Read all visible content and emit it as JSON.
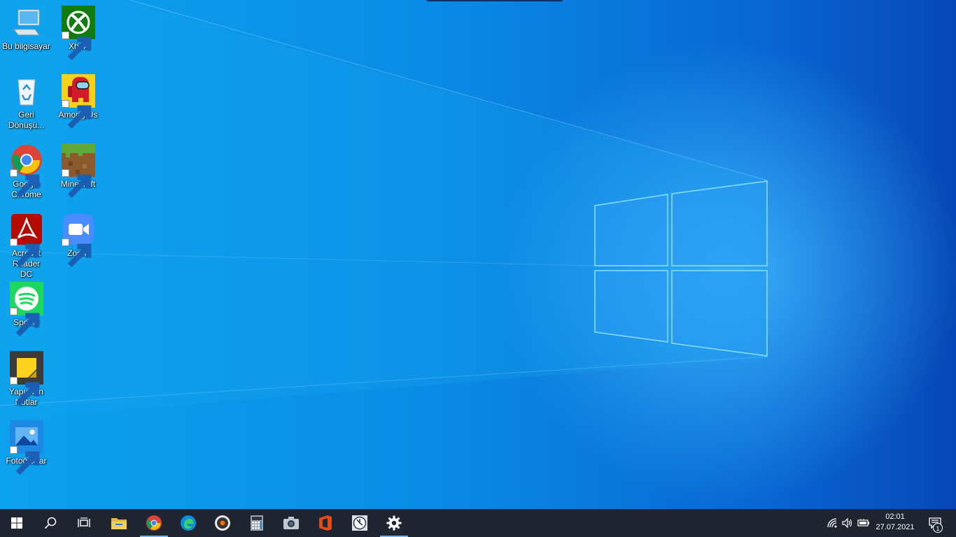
{
  "desktop": {
    "icons": [
      {
        "label": "Bu bilgisayar",
        "icon": "this-pc-icon"
      },
      {
        "label": "Xbox",
        "icon": "xbox-icon"
      },
      {
        "label": "Geri Dönüşü...",
        "icon": "recycle-bin-icon"
      },
      {
        "label": "Among Us",
        "icon": "among-us-icon"
      },
      {
        "label": "Google Chrome",
        "icon": "chrome-icon"
      },
      {
        "label": "Minecraft",
        "icon": "minecraft-icon"
      },
      {
        "label": "Acrobat Reader DC",
        "icon": "acrobat-icon"
      },
      {
        "label": "Zoom",
        "icon": "zoom-icon"
      },
      {
        "label": "Spotify",
        "icon": "spotify-icon"
      },
      {
        "label": "Yapışkan Notlar",
        "icon": "sticky-notes-icon"
      },
      {
        "label": "Fotoğraflar",
        "icon": "photos-icon"
      }
    ]
  },
  "taskbar": {
    "apps": [
      "start-icon",
      "search-icon",
      "task-view-icon",
      "file-explorer-icon",
      "chrome-icon",
      "edge-icon",
      "groove-music-icon",
      "calculator-icon",
      "camera-icon",
      "office-icon",
      "alarms-clock-icon",
      "settings-icon"
    ],
    "tray": [
      "network-icon",
      "volume-icon",
      "battery-icon"
    ],
    "clock": {
      "time": "02:01",
      "date": "27.07.2021"
    },
    "notification_count": "1"
  },
  "colors": {
    "taskbar": "#1f2530",
    "wallpaper": "#0a86e8",
    "accent": "#7ab3e6"
  }
}
